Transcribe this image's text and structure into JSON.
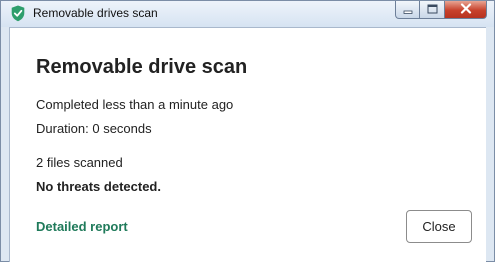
{
  "window": {
    "title": "Removable drives scan",
    "app_icon": "shield-check-icon"
  },
  "caption_buttons": {
    "minimize_icon": "minimize-icon",
    "maximize_icon": "maximize-icon",
    "close_icon": "close-icon"
  },
  "scan": {
    "heading": "Removable drive scan",
    "completed": "Completed less than a minute ago",
    "duration": "Duration: 0 seconds",
    "files_scanned": "2 files scanned",
    "result": "No threats detected."
  },
  "actions": {
    "report_link": "Detailed report",
    "close_label": "Close"
  },
  "colors": {
    "accent_green": "#1f7a5a",
    "shield_green": "#2e9e6c",
    "close_caption_red": "#c7412b"
  }
}
